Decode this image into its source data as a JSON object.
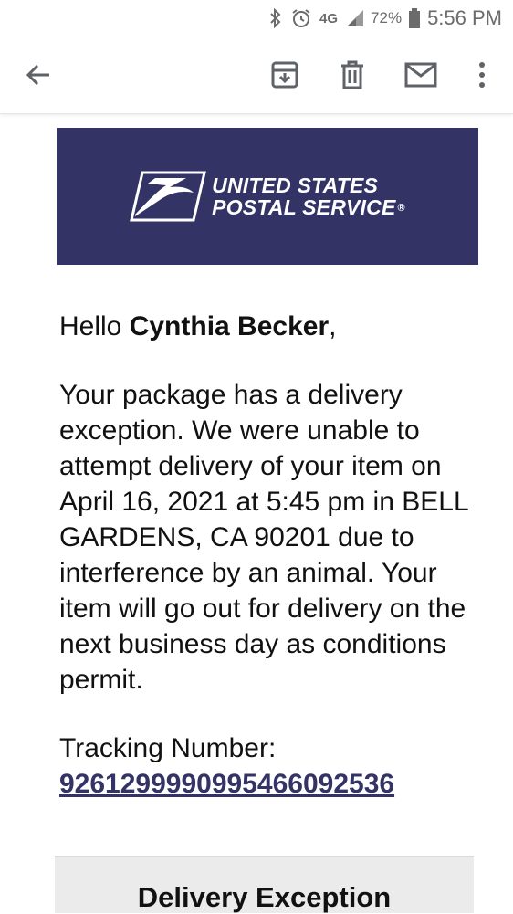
{
  "status_bar": {
    "network": "4G",
    "battery": "72%",
    "time": "5:56 PM"
  },
  "toolbar": {
    "icons": [
      "back-arrow-icon",
      "archive-icon",
      "delete-icon",
      "mail-icon",
      "more-vert-icon"
    ]
  },
  "banner": {
    "line1": "UNITED STATES",
    "line2": "POSTAL SERVICE",
    "registered": "®",
    "bg_color": "#333366"
  },
  "email": {
    "greeting_prefix": "Hello ",
    "recipient": "Cynthia Becker",
    "greeting_suffix": ",",
    "body": "Your package has a delivery exception. We were unable to attempt delivery of your item on April 16, 2021 at 5:45 pm in BELL GARDENS, CA 90201 due to interference by an animal. Your item will go out for delivery on the next business day as conditions permit.",
    "tracking_label": "Tracking Number:",
    "tracking_number": "9261299990995466092536",
    "box_title": "Delivery Exception"
  }
}
